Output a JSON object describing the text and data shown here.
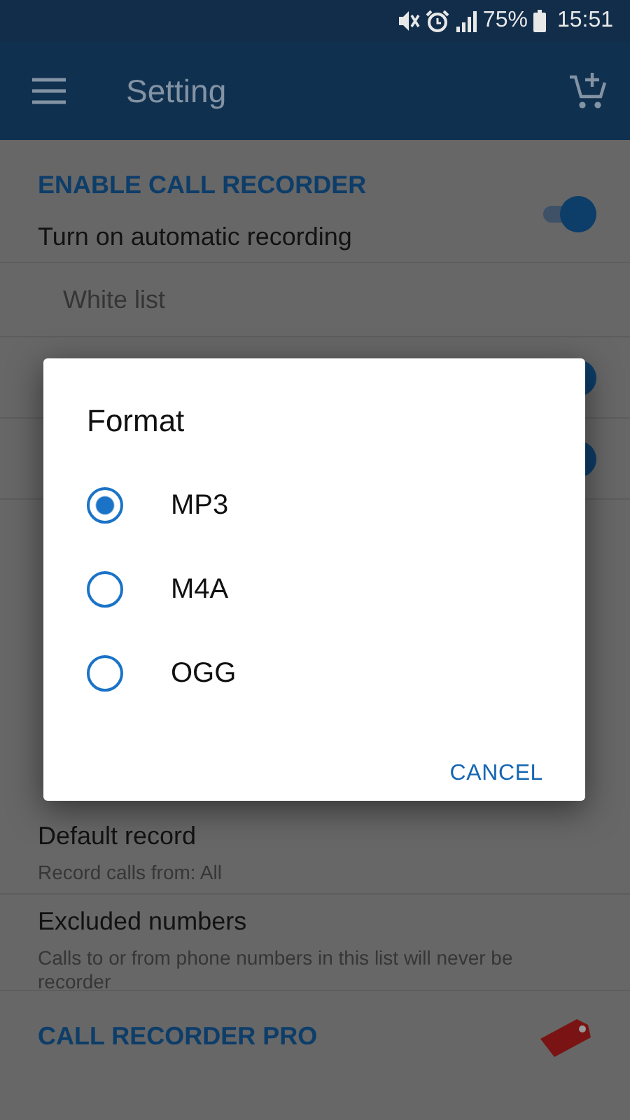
{
  "status_bar": {
    "battery": "75%",
    "time": "15:51"
  },
  "app_bar": {
    "title": "Setting"
  },
  "settings": [
    {
      "kind": "header",
      "title": "ENABLE CALL RECORDER"
    },
    {
      "kind": "toggle",
      "title": "Turn on automatic recording",
      "on": true
    },
    {
      "kind": "link",
      "title": "White list"
    },
    {
      "kind": "covered_toggle",
      "on": true
    },
    {
      "kind": "covered_toggle",
      "on": true
    },
    {
      "kind": "item",
      "title": "Default record",
      "subtitle": "Record calls from: All"
    },
    {
      "kind": "item",
      "title": "Excluded numbers",
      "subtitle": "Calls to or from phone numbers in this list will never be recorder"
    },
    {
      "kind": "pro_header",
      "title": "CALL RECORDER PRO"
    }
  ],
  "dialog": {
    "title": "Format",
    "options": [
      {
        "label": "MP3",
        "selected": true
      },
      {
        "label": "M4A",
        "selected": false
      },
      {
        "label": "OGG",
        "selected": false
      }
    ],
    "buttons": [
      "CANCEL"
    ]
  }
}
